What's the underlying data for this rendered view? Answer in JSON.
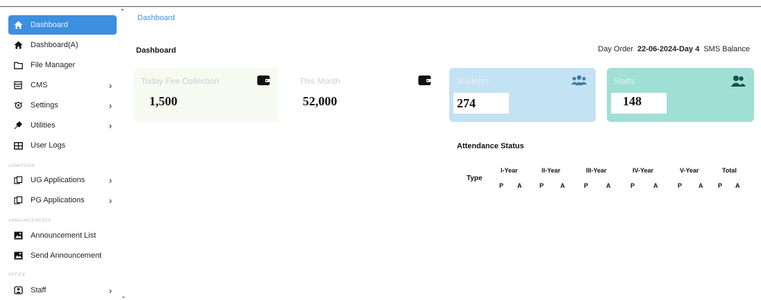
{
  "sidebar": {
    "items": [
      {
        "label": "Dashboard",
        "icon": "home-icon",
        "active": true,
        "chevron": false
      },
      {
        "label": "Dashboard(A)",
        "icon": "home-icon",
        "active": false,
        "chevron": false
      },
      {
        "label": "File Manager",
        "icon": "folder-icon",
        "active": false,
        "chevron": false
      },
      {
        "label": "CMS",
        "icon": "cms-icon",
        "active": false,
        "chevron": true
      },
      {
        "label": "Settings",
        "icon": "settings-icon",
        "active": false,
        "chevron": true
      },
      {
        "label": "Utilities",
        "icon": "utilities-icon",
        "active": false,
        "chevron": true
      },
      {
        "label": "User Logs",
        "icon": "table-icon",
        "active": false,
        "chevron": false
      },
      {
        "label": "UG Applications",
        "icon": "applications-icon",
        "active": false,
        "chevron": true
      },
      {
        "label": "PG Applications",
        "icon": "applications-icon",
        "active": false,
        "chevron": true
      },
      {
        "label": "Announcement List",
        "icon": "image-icon",
        "active": false,
        "chevron": false
      },
      {
        "label": "Send Announcement",
        "icon": "image-icon",
        "active": false,
        "chevron": false
      },
      {
        "label": "Staff",
        "icon": "staff-icon",
        "active": false,
        "chevron": true
      }
    ],
    "sections": {
      "admission": "ADMISSION",
      "announcement": "ANNOUNCEMENTS",
      "office": "OFFICE"
    },
    "chevron_glyph": "›"
  },
  "main": {
    "breadcrumb": "Dashboard",
    "title": "Dashboard",
    "day_order_label": "Day Order",
    "day_order_value": "22-06-2024-Day 4",
    "sms_balance_label": "SMS Balance"
  },
  "cards": [
    {
      "label": "Today Fee Collection",
      "value": "1,500",
      "icon": "wallet-icon",
      "bg": "#f7faf0",
      "label_color": "#c8cfd6"
    },
    {
      "label": "This Month",
      "value": "52,000",
      "icon": "wallet-icon",
      "bg": "#ffffff",
      "label_color": "#c8cfd6"
    },
    {
      "label": "Students",
      "value": "274",
      "icon": "users-icon",
      "bg": "#c3e2f3",
      "label_color": "#e4f2fb"
    },
    {
      "label": "Staffs",
      "value": "148",
      "icon": "users-icon",
      "bg": "#9fdfd6",
      "label_color": "#d9f4f0"
    }
  ],
  "attendance": {
    "title": "Attendance Status",
    "type_label": "Type",
    "columns": [
      "I-Year",
      "II-Year",
      "III-Year",
      "IV-Year",
      "V-Year",
      "Total"
    ],
    "sub_labels": [
      "P",
      "A"
    ]
  },
  "colors": {
    "accent": "#3d8fe0",
    "students_icon": "#3a7ca6",
    "staffs_icon": "#1f4f4a"
  }
}
